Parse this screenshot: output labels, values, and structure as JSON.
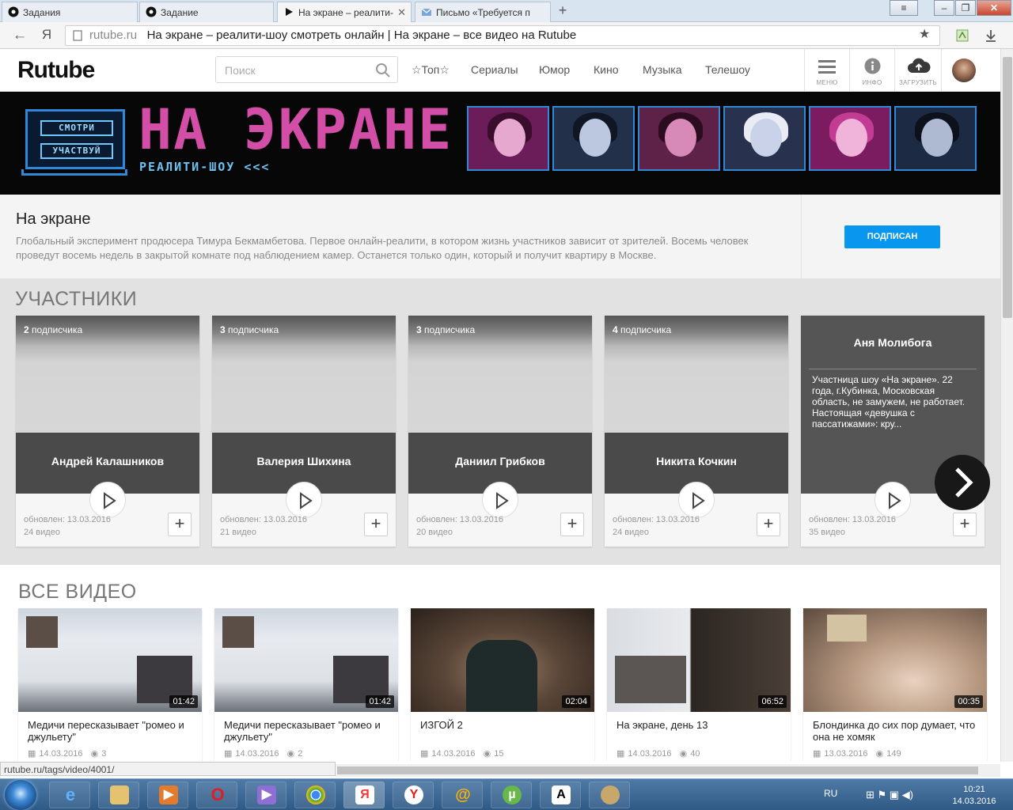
{
  "browser": {
    "tabs": [
      {
        "title": "Задания"
      },
      {
        "title": "Задание"
      },
      {
        "title": "На экране – реалити-"
      },
      {
        "title": "Письмо «Требуется п"
      }
    ],
    "url_host": "rutube.ru",
    "url_title": "На экране – реалити-шоу смотреть онлайн | На экране – все видео на Rutube",
    "yandex_logo": "Я"
  },
  "site": {
    "logo": "Rutube",
    "search_placeholder": "Поиск",
    "nav": [
      "☆Топ☆",
      "Сериалы",
      "Юмор",
      "Кино",
      "Музыка",
      "Телешоу"
    ],
    "header_buttons": [
      "МЕНЮ",
      "ИНФО",
      "ЗАГРУЗИТЬ"
    ]
  },
  "banner": {
    "btn_watch": "СМОТРИ",
    "btn_join": "УЧАСТВУЙ",
    "title": "НА ЭКРАНЕ",
    "subtitle": "РЕАЛИТИ-ШОУ <<<"
  },
  "description": {
    "title": "На экране",
    "text": "Глобальный эксперимент продюсера Тимура Бекмамбетова. Первое онлайн-реалити, в котором жизнь участников зависит от зрителей. Восемь человек проведут восемь недель в закрытой комнате под наблюдением камер. Останется только один, который и получит квартиру в Москве.",
    "subscribe_label": "ПОДПИСАН"
  },
  "participants": {
    "title": "УЧАСТНИКИ",
    "cards": [
      {
        "subs_num": "2",
        "subs_word": "подписчика",
        "name": "Андрей Калашников",
        "updated": "обновлен: 13.03.2016",
        "videos": "24 видео"
      },
      {
        "subs_num": "3",
        "subs_word": "подписчика",
        "name": "Валерия Шихина",
        "updated": "обновлен: 13.03.2016",
        "videos": "21 видео"
      },
      {
        "subs_num": "3",
        "subs_word": "подписчика",
        "name": "Даниил Грибков",
        "updated": "обновлен: 13.03.2016",
        "videos": "20 видео"
      },
      {
        "subs_num": "4",
        "subs_word": "подписчика",
        "name": "Никита Кочкин",
        "updated": "обновлен: 13.03.2016",
        "videos": "24 видео"
      }
    ],
    "featured": {
      "name": "Аня Молибога",
      "text": "Участница шоу «На экране». 22 года, г.Кубинка, Московская область, не замужем, не работает. Настоящая «девушка с пассатижами»: кру...",
      "updated": "обновлен: 13.03.2016",
      "videos": "35 видео"
    }
  },
  "videos": {
    "title": "ВСЕ ВИДЕО",
    "items": [
      {
        "title": "Медичи пересказывает \"ромео и джульету\"",
        "date": "14.03.2016",
        "views": "3",
        "duration": "01:42"
      },
      {
        "title": "Медичи пересказывает \"ромео и джульету\"",
        "date": "14.03.2016",
        "views": "2",
        "duration": "01:42"
      },
      {
        "title": "ИЗГОЙ 2",
        "date": "14.03.2016",
        "views": "15",
        "duration": "02:04"
      },
      {
        "title": "На экране, день 13",
        "date": "14.03.2016",
        "views": "40",
        "duration": "06:52"
      },
      {
        "title": "Блондинка до сих пор думает, что она не хомяк",
        "date": "13.03.2016",
        "views": "149",
        "duration": "00:35"
      }
    ]
  },
  "status_url": "rutube.ru/tags/video/4001/",
  "taskbar": {
    "lang": "RU",
    "time": "10:21",
    "date": "14.03.2016"
  },
  "colors": {
    "accent_blue": "#0896ef",
    "banner_pink": "#d24ea7",
    "banner_blue": "#2f89d8"
  }
}
